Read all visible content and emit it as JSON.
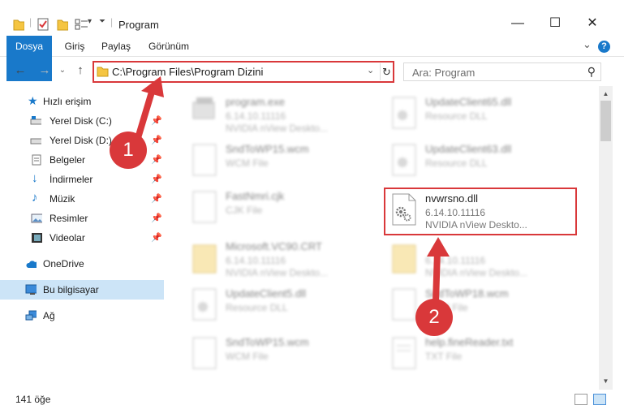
{
  "window": {
    "title": "Program",
    "minimize": "—",
    "maximize": "☐",
    "close": "✕"
  },
  "ribbon": {
    "tabs": [
      "Dosya",
      "Giriş",
      "Paylaş",
      "Görünüm"
    ],
    "expand": "⌄",
    "help": "?"
  },
  "address": {
    "path": "C:\\Program Files\\Program Dizini",
    "dropdown": "⌄",
    "refresh": "↻"
  },
  "search": {
    "placeholder": "Ara: Program"
  },
  "sidebar": {
    "items": [
      {
        "label": "Hızlı erişim"
      },
      {
        "label": "Yerel Disk (C:)"
      },
      {
        "label": "Yerel Disk (D:)"
      },
      {
        "label": "Belgeler"
      },
      {
        "label": "İndirmeler"
      },
      {
        "label": "Müzik"
      },
      {
        "label": "Resimler"
      },
      {
        "label": "Videolar"
      },
      {
        "label": "OneDrive"
      },
      {
        "label": "Bu bilgisayar"
      },
      {
        "label": "Ağ"
      }
    ]
  },
  "files": [
    {
      "name": "program.exe",
      "line2": "6.14.10.11116",
      "line3": "NVIDIA nView Deskto..."
    },
    {
      "name": "UpdateClient65.dll",
      "line2": "Resource DLL",
      "line3": ""
    },
    {
      "name": "SndToWP15.wcm",
      "line2": "WCM File",
      "line3": ""
    },
    {
      "name": "UpdateClient63.dll",
      "line2": "Resource DLL",
      "line3": ""
    },
    {
      "name": "FastNmri.cjk",
      "line2": "CJK File",
      "line3": ""
    },
    {
      "name": "nvwrsno.dll",
      "line2": "6.14.10.11116",
      "line3": "NVIDIA nView Deskto..."
    },
    {
      "name": "Microsoft.VC90.CRT",
      "line2": "6.14.10.11116",
      "line3": "NVIDIA nView Deskto..."
    },
    {
      "name": "",
      "line2": "6.14.10.11116",
      "line3": "NVIDIA nView Deskto..."
    },
    {
      "name": "UpdateClient5.dll",
      "line2": "Resource DLL",
      "line3": ""
    },
    {
      "name": "SndToWP18.wcm",
      "line2": "WCM File",
      "line3": ""
    },
    {
      "name": "SndToWP15.wcm",
      "line2": "WCM File",
      "line3": ""
    },
    {
      "name": "help.fineReader.txt",
      "line2": "TXT File",
      "line3": ""
    }
  ],
  "status": {
    "count": "141 öğe"
  },
  "markers": {
    "one": "1",
    "two": "2"
  },
  "colors": {
    "accent": "#1979ca",
    "highlight": "#d9383a",
    "selected": "#cce4f7"
  }
}
